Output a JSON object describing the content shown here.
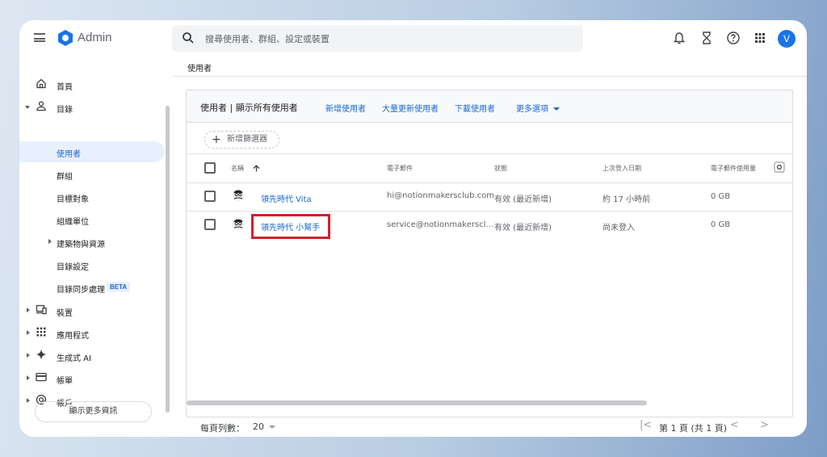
{
  "app": {
    "title": "Admin"
  },
  "search": {
    "placeholder": "搜尋使用者、群組、設定或裝置"
  },
  "header": {
    "avatar_initial": "V"
  },
  "sidebar": {
    "items": [
      {
        "label": "首頁"
      },
      {
        "label": "目錄"
      },
      {
        "label": "使用者"
      },
      {
        "label": "群組"
      },
      {
        "label": "目標對象"
      },
      {
        "label": "組織單位"
      },
      {
        "label": "建築物與資源"
      },
      {
        "label": "目錄設定"
      },
      {
        "label": "目錄同步處理"
      },
      {
        "label": "裝置"
      },
      {
        "label": "應用程式"
      },
      {
        "label": "生成式 AI"
      },
      {
        "label": "帳單"
      },
      {
        "label": "帳戶"
      }
    ],
    "beta_badge": "BETA",
    "more_button": "顯示更多資訊"
  },
  "main": {
    "breadcrumb": "使用者",
    "panel_title": "使用者 | 顯示所有使用者",
    "actions": {
      "add_user": "新增使用者",
      "bulk_update": "大量更新使用者",
      "download": "下載使用者",
      "more": "更多選項"
    },
    "add_filter": "新增篩選器",
    "columns": {
      "name": "名稱",
      "email": "電子郵件",
      "status": "狀態",
      "last_login": "上次登入日期",
      "storage": "電子郵件使用量"
    },
    "rows": [
      {
        "name": "領先時代 Vita",
        "email": "hi@notionmakersclub.com",
        "status": "有效 (最近新增)",
        "last_login": "約 17 小時前",
        "storage": "0 GB"
      },
      {
        "name": "領先時代 小幫手",
        "email": "service@notionmakerscl...",
        "status": "有效 (最近新增)",
        "last_login": "尚未登入",
        "storage": "0 GB"
      }
    ],
    "footer": {
      "rows_per_page_label": "每頁列數：",
      "rows_per_page_value": "20",
      "page_info": "第 1 頁 (共 1 頁)"
    }
  },
  "colors": {
    "accent": "#1967d2",
    "highlight_box": "#d3202a",
    "avatar_bg": "#1a73e8"
  },
  "icons": [
    "menu-icon",
    "admin-logo-icon",
    "search-icon",
    "bell-icon",
    "hourglass-icon",
    "help-icon",
    "apps-grid-icon",
    "home-icon",
    "person-icon",
    "devices-icon",
    "apps-icon",
    "sparkle-icon",
    "billing-icon",
    "account-icon",
    "sort-up-icon",
    "settings-icon"
  ]
}
